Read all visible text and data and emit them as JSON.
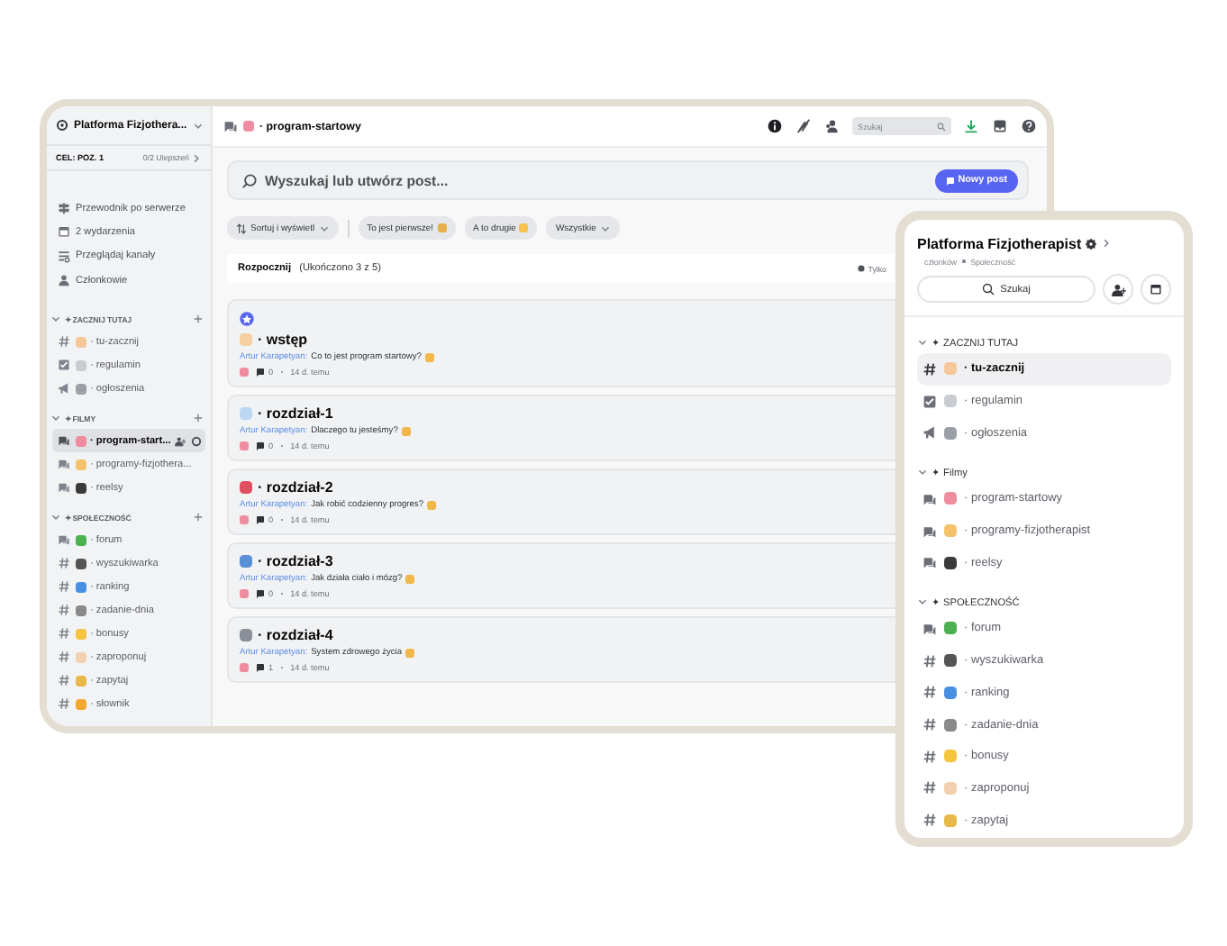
{
  "server": {
    "name": "Platforma Fizjothera...",
    "goal": "CEL: POZ. 1",
    "boosts": "0/2 Ulepszeń"
  },
  "nav": [
    {
      "label": "Przewodnik po serwerze",
      "kind": "guide"
    },
    {
      "label": "2 wydarzenia",
      "kind": "events"
    },
    {
      "label": "Przeglądaj kanały",
      "kind": "browse"
    },
    {
      "label": "Członkowie",
      "kind": "members"
    }
  ],
  "sidebar": {
    "categories": [
      {
        "name": "✦ ZACZNIJ TUTAJ",
        "channels": [
          {
            "name": "· tu-zacznij",
            "kind": "text",
            "color": "#f5c79a",
            "selected": false
          },
          {
            "name": "· regulamin",
            "kind": "rules",
            "color": "#c9ccd1",
            "selected": false
          },
          {
            "name": "· ogłoszenia",
            "kind": "announce",
            "color": "#9aa0a6",
            "selected": false
          }
        ]
      },
      {
        "name": "✦ FILMY",
        "channels": [
          {
            "name": "· program-start...",
            "kind": "forum",
            "color": "#f08ca0",
            "selected": true
          },
          {
            "name": "· programy-fizjothera...",
            "kind": "forum",
            "color": "#f5c26b",
            "selected": false
          },
          {
            "name": "· reelsy",
            "kind": "forum",
            "color": "#3b3b3b",
            "selected": false
          }
        ]
      },
      {
        "name": "✦ SPOŁECZNOŚĆ",
        "channels": [
          {
            "name": "· forum",
            "kind": "forum",
            "color": "#4caf50",
            "selected": false
          },
          {
            "name": "· wyszukiwarka",
            "kind": "text",
            "color": "#555555",
            "selected": false
          },
          {
            "name": "· ranking",
            "kind": "text",
            "color": "#4a90e2",
            "selected": false
          },
          {
            "name": "· zadanie-dnia",
            "kind": "text",
            "color": "#8a8a8a",
            "selected": false
          },
          {
            "name": "· bonusy",
            "kind": "text",
            "color": "#f5c542",
            "selected": false
          },
          {
            "name": "· zaproponuj",
            "kind": "text",
            "color": "#f3d0b0",
            "selected": false
          },
          {
            "name": "· zapytaj",
            "kind": "text",
            "color": "#e9b84a",
            "selected": false
          },
          {
            "name": "· słownik",
            "kind": "text",
            "color": "#f0a830",
            "selected": false
          }
        ]
      }
    ]
  },
  "channel_header": {
    "name": "· program-startowy",
    "color": "#f08ca0",
    "search_placeholder": "Szukaj"
  },
  "post_search": {
    "placeholder": "Wyszukaj lub utwórz post...",
    "button": "Nowy post"
  },
  "filters": [
    {
      "label": "Sortuj i wyświetl",
      "kind": "sort"
    },
    {
      "label": "To jest pierwsze!",
      "kind": "tag"
    },
    {
      "label": "A to drugie",
      "kind": "tag"
    },
    {
      "label": "Wszystkie",
      "kind": "menu"
    }
  ],
  "progress_bar": {
    "title": "Rozpocznij",
    "status": "(Ukończono 3 z 5)",
    "note": "Tylko"
  },
  "posts": [
    {
      "pinned": true,
      "color": "#f5cfa0",
      "title": "· wstęp",
      "author": "Artur Karapetyan:",
      "text": "Co to jest program startowy?",
      "replies": "0",
      "age": "14 d. temu"
    },
    {
      "pinned": false,
      "color": "#bcd7f2",
      "title": "· rozdział-1",
      "author": "Artur Karapetyan:",
      "text": "Dlaczego tu jesteśmy?",
      "replies": "0",
      "age": "14 d. temu"
    },
    {
      "pinned": false,
      "color": "#e04f5f",
      "title": "· rozdział-2",
      "author": "Artur Karapetyan:",
      "text": "Jak robić codzienny progres?",
      "replies": "0",
      "age": "14 d. temu"
    },
    {
      "pinned": false,
      "color": "#5b8fd6",
      "title": "· rozdział-3",
      "author": "Artur Karapetyan:",
      "text": "Jak działa ciało i mózg?",
      "replies": "0",
      "age": "14 d. temu"
    },
    {
      "pinned": false,
      "color": "#8a8f98",
      "title": "· rozdział-4",
      "author": "Artur Karapetyan:",
      "text": "System zdrowego życia",
      "replies": "1",
      "age": "14 d. temu"
    }
  ],
  "phone": {
    "title": "Platforma Fizjotherapist",
    "members": "członków",
    "community": "Społeczność",
    "search": "Szukaj",
    "categories": [
      {
        "name": "✦ ZACZNIJ TUTAJ",
        "channels": [
          {
            "name": "· tu-zacznij",
            "kind": "text",
            "color": "#f5c79a",
            "selected": true
          },
          {
            "name": "· regulamin",
            "kind": "rules",
            "color": "#c9ccd1",
            "selected": false
          },
          {
            "name": "· ogłoszenia",
            "kind": "announce",
            "color": "#9aa0a6",
            "selected": false
          }
        ]
      },
      {
        "name": "✦ Filmy",
        "channels": [
          {
            "name": "· program-startowy",
            "kind": "forum",
            "color": "#f08ca0",
            "selected": false
          },
          {
            "name": "· programy-fizjotherapist",
            "kind": "forum",
            "color": "#f5c26b",
            "selected": false
          },
          {
            "name": "· reelsy",
            "kind": "forum",
            "color": "#3b3b3b",
            "selected": false
          }
        ]
      },
      {
        "name": "✦ SPOŁECZNOŚĆ",
        "channels": [
          {
            "name": "· forum",
            "kind": "forum",
            "color": "#4caf50",
            "selected": false
          },
          {
            "name": "· wyszukiwarka",
            "kind": "text",
            "color": "#555555",
            "selected": false
          },
          {
            "name": "· ranking",
            "kind": "text",
            "color": "#4a90e2",
            "selected": false
          },
          {
            "name": "· zadanie-dnia",
            "kind": "text",
            "color": "#8a8a8a",
            "selected": false
          },
          {
            "name": "· bonusy",
            "kind": "text",
            "color": "#f5c542",
            "selected": false
          },
          {
            "name": "· zaproponuj",
            "kind": "text",
            "color": "#f3d0b0",
            "selected": false
          },
          {
            "name": "· zapytaj",
            "kind": "text",
            "color": "#e9b84a",
            "selected": false
          }
        ]
      }
    ]
  }
}
